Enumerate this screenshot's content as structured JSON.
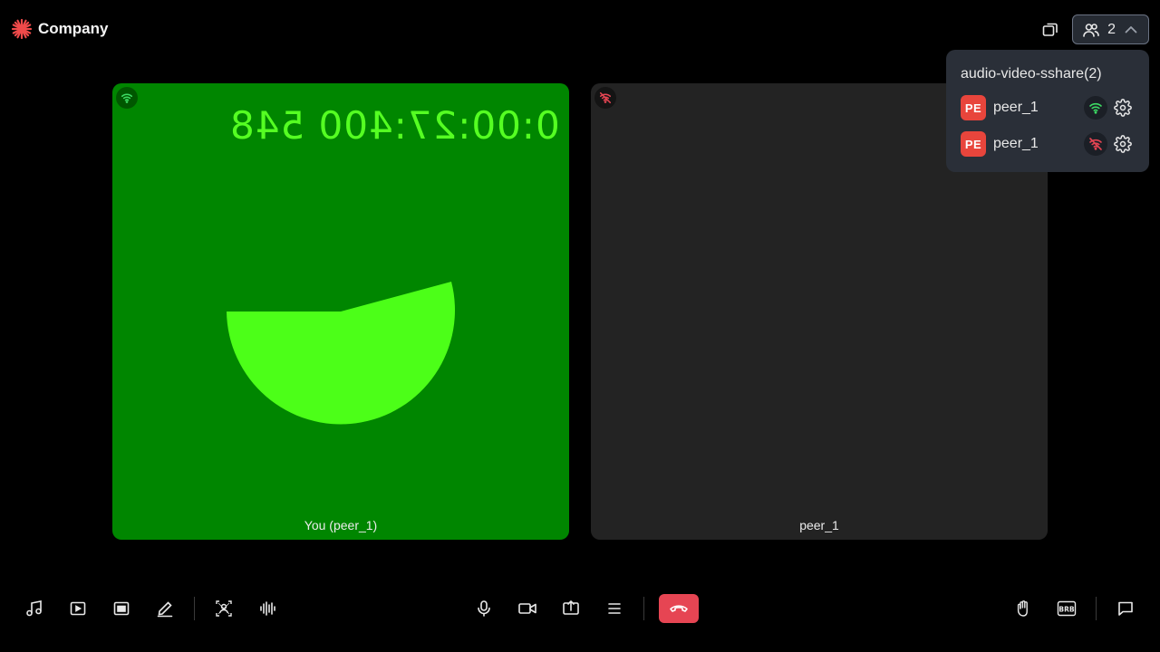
{
  "header": {
    "brand": "Company",
    "participant_count": "2"
  },
  "participants_popover": {
    "title": "audio-video-sshare(2)",
    "peers": [
      {
        "initials": "PE",
        "name": "peer_1",
        "network": "good"
      },
      {
        "initials": "PE",
        "name": "peer_1",
        "network": "disconnected"
      }
    ]
  },
  "tiles": [
    {
      "name": "You (peer_1)",
      "timer": "0:00:27:400 548",
      "background": "#008600",
      "network": "good"
    },
    {
      "name": "peer_1",
      "background": "#232323",
      "network": "disconnected"
    }
  ],
  "colors": {
    "accent_red": "#e8453c",
    "leave_red": "#e64553",
    "network_good": "#3ddc64",
    "network_bad": "#e64553",
    "video_green": "#55ff22"
  },
  "toolbar": {
    "left": [
      "music-icon",
      "video-playlist-icon",
      "pip-icon",
      "whiteboard-icon",
      "virtual-background-icon",
      "audio-waveform-icon"
    ],
    "center": [
      "microphone-icon",
      "camera-icon",
      "screen-share-icon",
      "more-options-icon",
      "leave-call-icon"
    ],
    "right": [
      "raise-hand-icon",
      "brb-icon",
      "chat-icon"
    ],
    "brb_label": "BRB"
  }
}
